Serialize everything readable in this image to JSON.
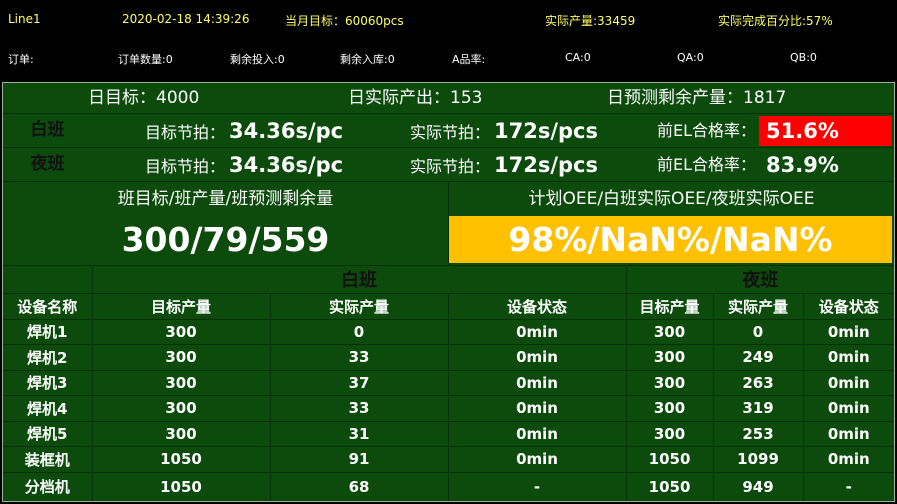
{
  "header": {
    "line": "Line1",
    "datetime": "2020-02-18 14:39:26",
    "month_target": "当月目标：60060pcs",
    "actual_output": "实际产量:33459",
    "completion": "实际完成百分比:57%"
  },
  "order_bar": {
    "order": "订单:",
    "order_qty": "订单数量:0",
    "remaining_input": "剩余投入:0",
    "remaining_storage": "剩余入库:0",
    "a_rate": "A品率:",
    "ca": "CA:0",
    "qa": "QA:0",
    "qb": "QB:0"
  },
  "daily": {
    "target_label": "日目标：",
    "target": "4000",
    "actual_label": "日实际产出：",
    "actual": "153",
    "forecast_label": "日预测剩余产量：",
    "forecast": "1817"
  },
  "shifts": [
    {
      "name": "白班",
      "target_takt_label": "目标节拍：",
      "target_takt": "34.36s/pc",
      "actual_takt_label": "实际节拍：",
      "actual_takt": "172s/pcs",
      "el_rate_label": "前EL合格率：",
      "el_rate": "51.6%",
      "el_alert": true
    },
    {
      "name": "夜班",
      "target_takt_label": "目标节拍：",
      "target_takt": "34.36s/pc",
      "actual_takt_label": "实际节拍：",
      "actual_takt": "172s/pcs",
      "el_rate_label": "前EL合格率：",
      "el_rate": "83.9%",
      "el_alert": false
    }
  ],
  "summary": {
    "shift_label": "班目标/班产量/班预测剩余量",
    "shift_value": "300/79/559",
    "oee_label": "计划OEE/白班实际OEE/夜班实际OEE",
    "oee_value": "98%/NaN%/NaN%"
  },
  "table": {
    "day_shift": "白班",
    "night_shift": "夜班",
    "columns": [
      "设备名称",
      "目标产量",
      "实际产量",
      "设备状态",
      "目标产量",
      "实际产量",
      "设备状态"
    ],
    "rows": [
      [
        "焊机1",
        "300",
        "0",
        "0min",
        "300",
        "0",
        "0min"
      ],
      [
        "焊机2",
        "300",
        "33",
        "0min",
        "300",
        "249",
        "0min"
      ],
      [
        "焊机3",
        "300",
        "37",
        "0min",
        "300",
        "263",
        "0min"
      ],
      [
        "焊机4",
        "300",
        "33",
        "0min",
        "300",
        "319",
        "0min"
      ],
      [
        "焊机5",
        "300",
        "31",
        "0min",
        "300",
        "253",
        "0min"
      ],
      [
        "装框机",
        "1050",
        "91",
        "0min",
        "1050",
        "1099",
        "0min"
      ],
      [
        "分档机",
        "1050",
        "68",
        "-",
        "1050",
        "949",
        "-"
      ]
    ]
  },
  "colors": {
    "header_text": "#ffff66",
    "panel_bg": "#0c4b0c",
    "alert_bg": "#ff0000",
    "oee_bg": "#ffc000",
    "shift_name_text": "#111111"
  }
}
